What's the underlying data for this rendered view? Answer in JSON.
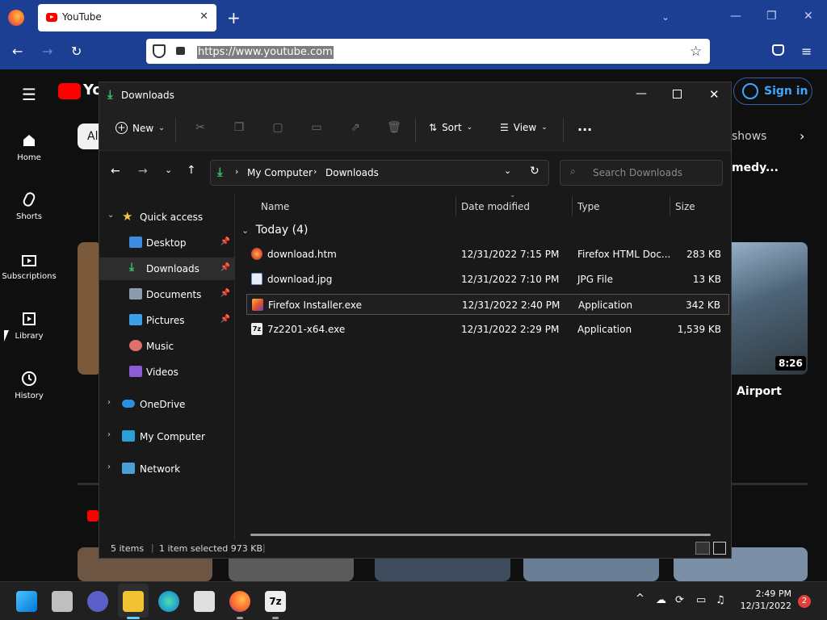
{
  "browser": {
    "tab_title": "YouTube",
    "url": "https://www.youtube.com"
  },
  "youtube": {
    "sign_in": "Sign in",
    "sidebar": [
      {
        "label": "Home"
      },
      {
        "label": "Shorts"
      },
      {
        "label": "Subscriptions"
      },
      {
        "label": "Library"
      },
      {
        "label": "History"
      }
    ],
    "chip_all": "All",
    "chip_shows": "shows",
    "video_title_fragment": "medy...",
    "airport_fragment": "Airport",
    "duration": "8:26"
  },
  "explorer": {
    "title": "Downloads",
    "toolbar": {
      "new": "New",
      "sort": "Sort",
      "view": "View",
      "more": "..."
    },
    "breadcrumb": [
      "My Computer",
      "Downloads"
    ],
    "search_placeholder": "Search Downloads",
    "nav": {
      "quick_access": "Quick access",
      "items": [
        {
          "label": "Desktop",
          "pinned": true
        },
        {
          "label": "Downloads",
          "pinned": true
        },
        {
          "label": "Documents",
          "pinned": true
        },
        {
          "label": "Pictures",
          "pinned": true
        },
        {
          "label": "Music",
          "pinned": false
        },
        {
          "label": "Videos",
          "pinned": false
        }
      ],
      "onedrive": "OneDrive",
      "my_computer": "My Computer",
      "network": "Network"
    },
    "columns": {
      "name": "Name",
      "date": "Date modified",
      "type": "Type",
      "size": "Size"
    },
    "group_label": "Today (4)",
    "files": [
      {
        "name": "download.htm",
        "date": "12/31/2022 7:15 PM",
        "type": "Firefox HTML Doc...",
        "size": "283 KB"
      },
      {
        "name": "download.jpg",
        "date": "12/31/2022 7:10 PM",
        "type": "JPG File",
        "size": "13 KB"
      },
      {
        "name": "Firefox Installer.exe",
        "date": "12/31/2022 2:40 PM",
        "type": "Application",
        "size": "342 KB"
      },
      {
        "name": "7z2201-x64.exe",
        "date": "12/31/2022 2:29 PM",
        "type": "Application",
        "size": "1,539 KB"
      }
    ],
    "status": {
      "items": "5 items",
      "selected": "1 item selected  973 KB"
    }
  },
  "taskbar": {
    "time": "2:49 PM",
    "date": "12/31/2022",
    "notification_count": "2"
  }
}
